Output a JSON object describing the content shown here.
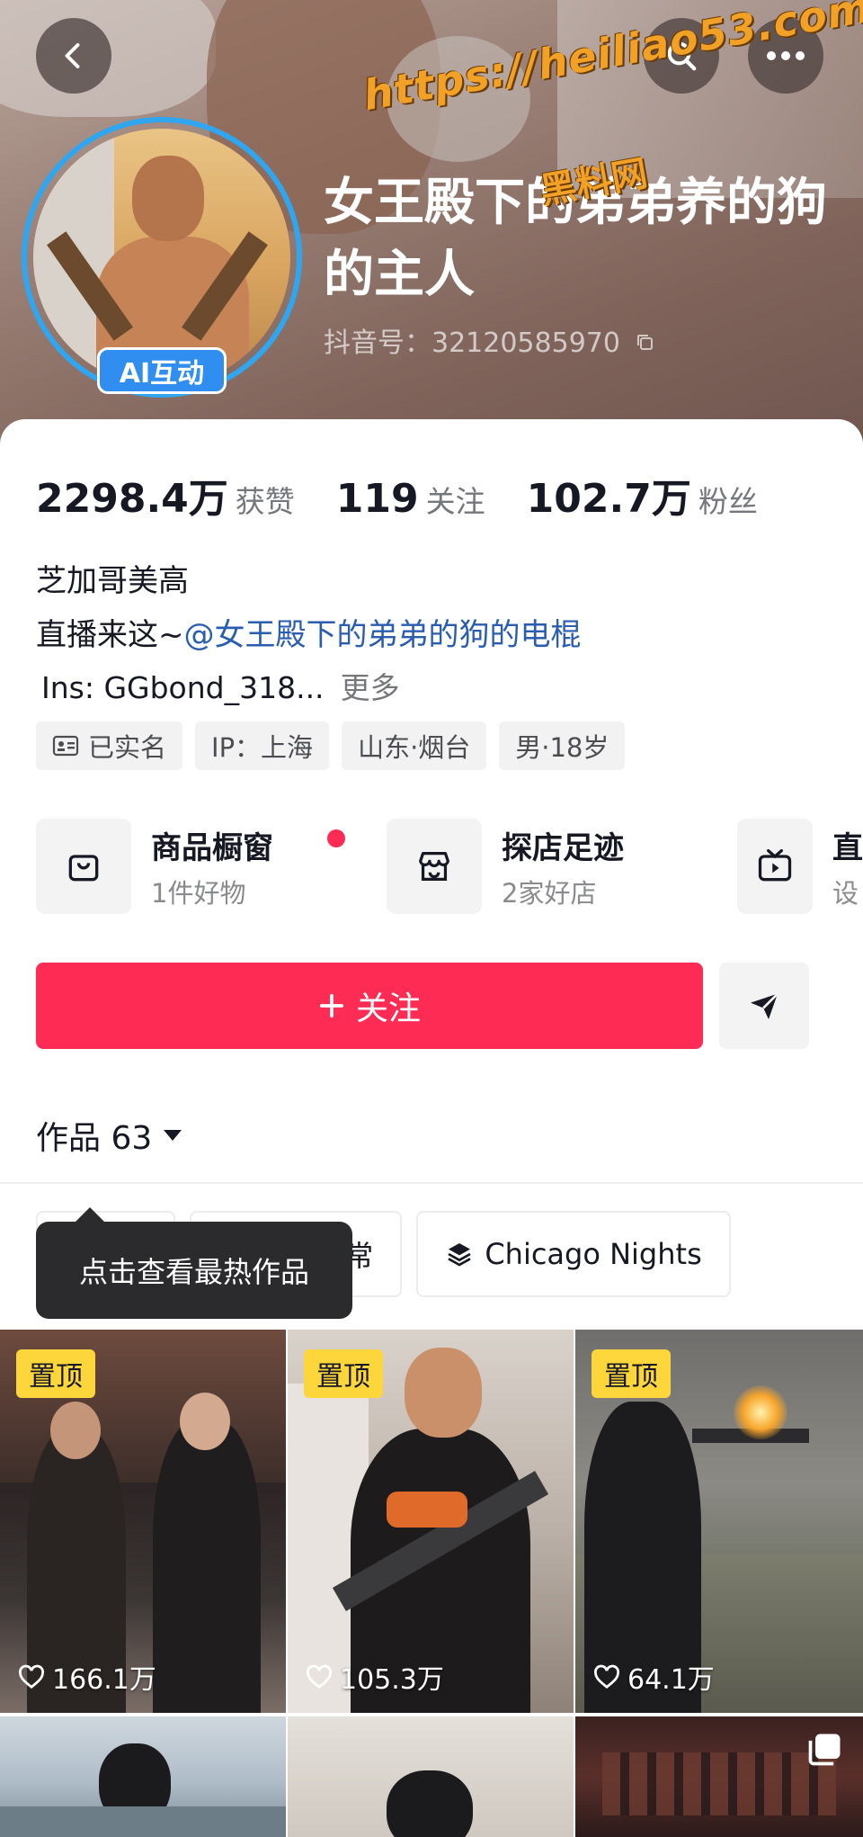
{
  "header": {
    "watermark_url": "https://heiliao53.com",
    "watermark_site": "黑料网",
    "ai_badge": "AI互动",
    "name": "女王殿下的弟弟养的狗的主人",
    "douyin_id": "抖音号：32120585970"
  },
  "stats": [
    {
      "value": "2298.4万",
      "label": "获赞"
    },
    {
      "value": "119",
      "label": "关注"
    },
    {
      "value": "102.7万",
      "label": "粉丝"
    }
  ],
  "bio": {
    "line1": "芝加哥美高",
    "line2_prefix": "直播来这~",
    "line2_mention": "@女王殿下的弟弟的狗的电棍",
    "ins": "Ins: GGbond_318...",
    "more": "更多"
  },
  "tags": [
    "已实名",
    "IP：上海",
    "山东·烟台",
    "男·18岁"
  ],
  "shortcuts": [
    {
      "title": "商品橱窗",
      "sub": "1件好物",
      "icon": "bag-icon"
    },
    {
      "title": "探店足迹",
      "sub": "2家好店",
      "icon": "shop-icon"
    },
    {
      "title": "直",
      "sub": "设",
      "icon": "tv-icon"
    }
  ],
  "actions": {
    "follow_label": "关注",
    "works_label": "作品 63"
  },
  "chips": [
    "Me",
    "美高日常",
    "Chicago Nights"
  ],
  "tooltip": "点击查看最热作品",
  "videos": [
    {
      "pin": "置顶",
      "likes": "166.1万"
    },
    {
      "pin": "置顶",
      "likes": "105.3万"
    },
    {
      "pin": "置顶",
      "likes": "64.1万"
    }
  ],
  "colors": {
    "accent": "#fe2c55",
    "pin": "#fdd63b",
    "ai_badge": "#2f8ef0",
    "mention": "#2a5db0"
  }
}
